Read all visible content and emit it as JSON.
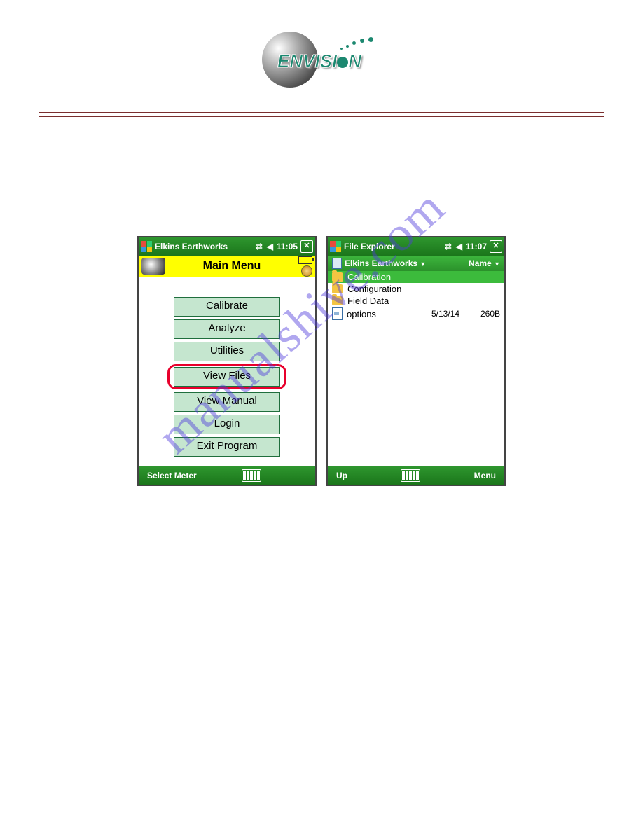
{
  "logo": {
    "text_pre": "ENVISI",
    "text_post": "N"
  },
  "watermark": "manualshive.com",
  "screen_left": {
    "titlebar": {
      "app": "Elkins Earthworks",
      "time": "11:05"
    },
    "header": {
      "title": "Main Menu"
    },
    "buttons": {
      "calibrate": "Calibrate",
      "analyze": "Analyze",
      "utilities": "Utilities",
      "view_files": "View Files",
      "view_manual": "View Manual",
      "login": "Login",
      "exit": "Exit Program"
    },
    "softbar": {
      "left": "Select Meter",
      "right": ""
    }
  },
  "screen_right": {
    "titlebar": {
      "app": "File Explorer",
      "time": "11:07"
    },
    "locbar": {
      "path": "Elkins Earthworks",
      "sort": "Name"
    },
    "files": {
      "calibration": {
        "name": "Calibration"
      },
      "configuration": {
        "name": "Configuration"
      },
      "field_data": {
        "name": "Field Data"
      },
      "options": {
        "name": "options",
        "date": "5/13/14",
        "size": "260B"
      }
    },
    "softbar": {
      "left": "Up",
      "right": "Menu"
    }
  }
}
